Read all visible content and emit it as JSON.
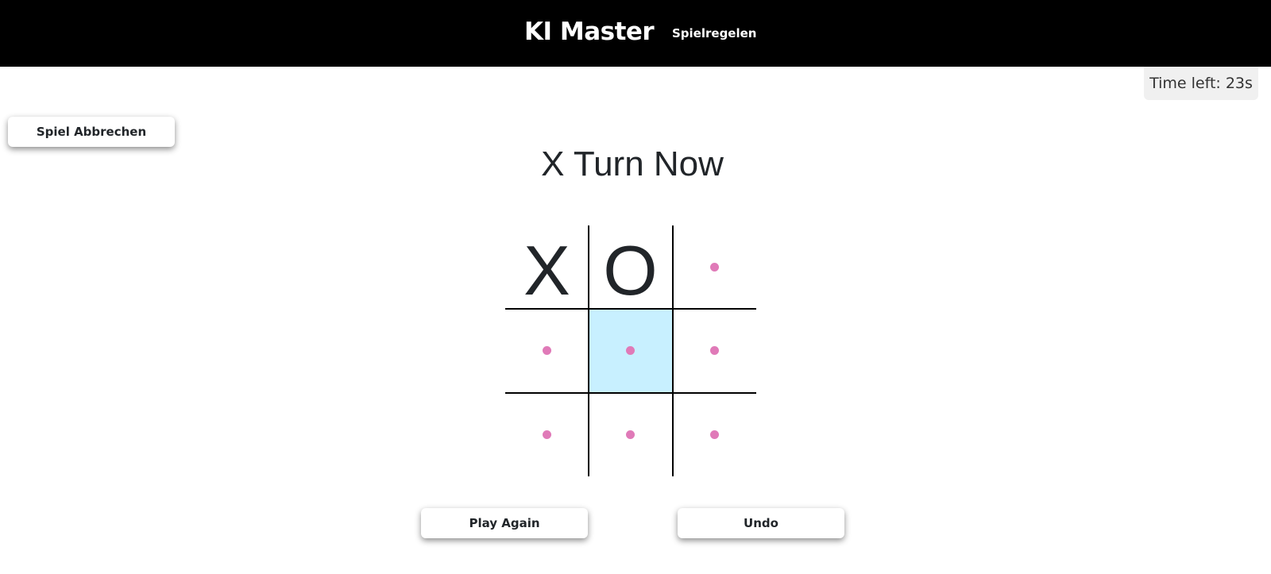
{
  "header": {
    "brand": "KI Master",
    "nav_rules": "Spielregelen"
  },
  "timer": {
    "text": "Time left: 23s"
  },
  "buttons": {
    "abort": "Spiel Abbrechen",
    "play_again": "Play Again",
    "undo": "Undo"
  },
  "status": {
    "turn_text": "X Turn Now"
  },
  "board": {
    "cells": [
      "X",
      "O",
      "",
      "",
      "",
      "",
      "",
      "",
      ""
    ],
    "highlighted_cell": 4
  },
  "colors": {
    "header_bg": "#000000",
    "highlight": "#c8f0ff",
    "dot": "#e07ab8",
    "timer_bg": "#f0f0f0"
  }
}
